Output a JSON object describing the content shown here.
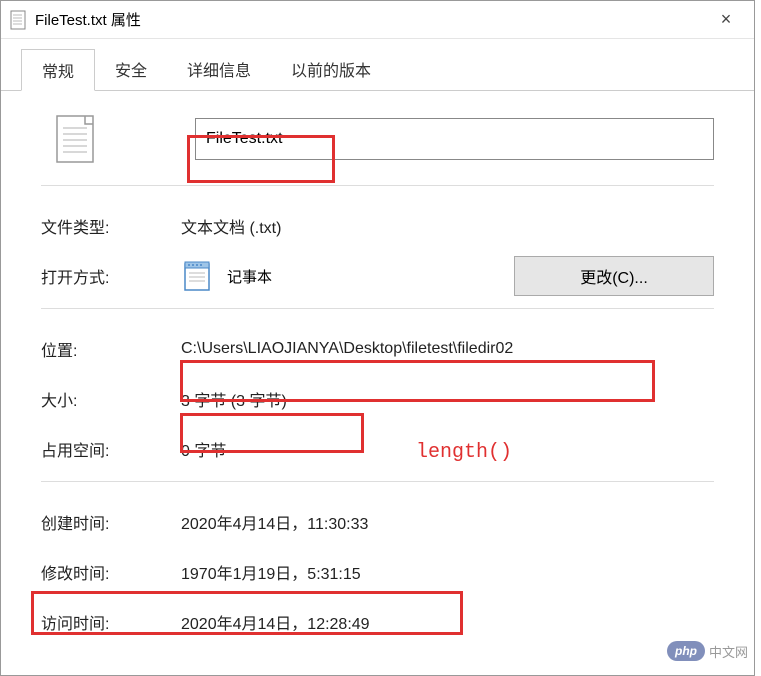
{
  "window": {
    "title": "FileTest.txt 属性",
    "close_symbol": "×"
  },
  "tabs": [
    {
      "label": "常规",
      "active": true
    },
    {
      "label": "安全",
      "active": false
    },
    {
      "label": "详细信息",
      "active": false
    },
    {
      "label": "以前的版本",
      "active": false
    }
  ],
  "filename": "FileTest.txt",
  "fields": {
    "file_type": {
      "label": "文件类型:",
      "value": "文本文档 (.txt)"
    },
    "open_with": {
      "label": "打开方式:",
      "value": "记事本"
    },
    "change_button": "更改(C)...",
    "location": {
      "label": "位置:",
      "value": "C:\\Users\\LIAOJIANYA\\Desktop\\filetest\\filedir02"
    },
    "size": {
      "label": "大小:",
      "value": "3 字节 (3 字节)"
    },
    "size_on_disk": {
      "label": "占用空间:",
      "value": "0 字节"
    },
    "created": {
      "label": "创建时间:",
      "value": "2020年4月14日，11:30:33"
    },
    "modified": {
      "label": "修改时间:",
      "value": "1970年1月19日，5:31:15"
    },
    "accessed": {
      "label": "访问时间:",
      "value": "2020年4月14日，12:28:49"
    }
  },
  "annotation": {
    "length_text": "length()"
  },
  "watermark": {
    "php": "php",
    "text": "中文网"
  }
}
